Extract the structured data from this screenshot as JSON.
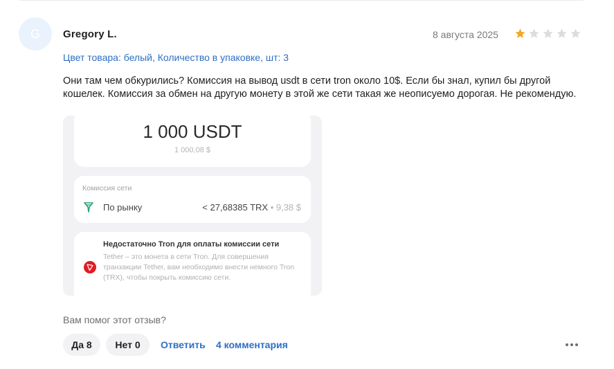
{
  "review": {
    "avatar_letter": "G",
    "author": "Gregory L.",
    "date": "8 августа 2025",
    "rating": 1,
    "max_rating": 5,
    "attributes": "Цвет товара: белый, Количество в упаковке, шт: 3",
    "text": "Они там чем обкурились? Комиссия на вывод usdt в сети tron около 10$. Если бы знал, купил бы другой кошелек. Комиссия за обмен на другую монету в этой же сети такая же неописуемо дорогая. Не рекомендую."
  },
  "photo": {
    "amount": "1 000 USDT",
    "amount_usd": "1 000,08 $",
    "fee_title": "Комиссия сети",
    "fee_label": "По рынку",
    "fee_value": "< 27,68385 TRX",
    "fee_usd": " • 9,38 $",
    "warning_title": "Недостаточно Tron для оплаты комиссии сети",
    "warning_body": "Tether – это монета в сети Tron. Для совершения транзакции Tether, вам необходимо внести немного Tron (TRX), чтобы покрыть комиссию сети."
  },
  "actions": {
    "helpful_question": "Вам помог этот отзыв?",
    "yes_label": "Да 8",
    "no_label": "Нет 0",
    "reply_label": "Ответить",
    "comments_label": "4 комментария"
  },
  "colors": {
    "star_filled": "#f5a623",
    "star_empty": "#dcdcdc",
    "link": "#2c6fc4",
    "tron_red": "#e31b23",
    "tether_teal": "#26a17b"
  }
}
